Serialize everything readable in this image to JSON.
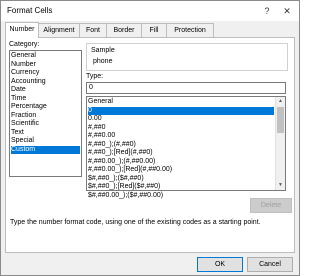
{
  "window": {
    "title": "Format Cells",
    "help_label": "?",
    "close_label": "✕"
  },
  "tabs": [
    {
      "label": "Number"
    },
    {
      "label": "Alignment"
    },
    {
      "label": "Font"
    },
    {
      "label": "Border"
    },
    {
      "label": "Fill"
    },
    {
      "label": "Protection"
    }
  ],
  "category": {
    "label": "Category:",
    "items": [
      "General",
      "Number",
      "Currency",
      "Accounting",
      "Date",
      "Time",
      "Percentage",
      "Fraction",
      "Scientific",
      "Text",
      "Special",
      "Custom"
    ],
    "selected": "Custom"
  },
  "sample": {
    "label": "Sample",
    "value": "phone"
  },
  "type": {
    "label": "Type:",
    "value": "0",
    "items": [
      "General",
      "0",
      "0.00",
      "#,##0",
      "#,##0.00",
      "#,##0_);(#,##0)",
      "#,##0_);[Red](#,##0)",
      "#,##0.00_);(#,##0.00)",
      "#,##0.00_);[Red](#,##0.00)",
      "$#,##0_);($#,##0)",
      "$#,##0_);[Red]($#,##0)",
      "$#,##0.00_);($#,##0.00)"
    ],
    "selected": "0"
  },
  "delete_label": "Delete",
  "description": "Type the number format code, using one of the existing codes as a starting point.",
  "footer": {
    "ok_label": "OK",
    "cancel_label": "Cancel"
  },
  "colors": {
    "accent": "#0078d7"
  }
}
